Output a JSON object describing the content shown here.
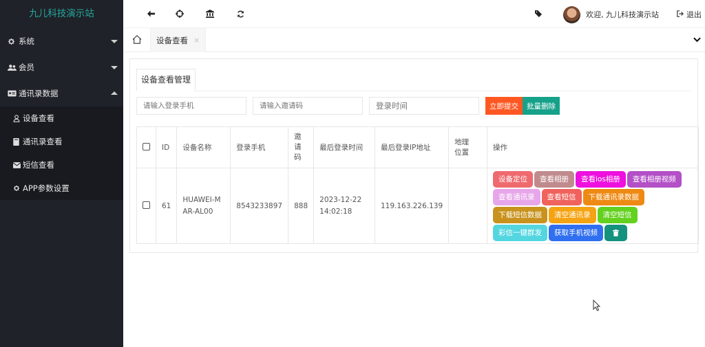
{
  "app": {
    "brand": "九儿科技演示站"
  },
  "sidebar": {
    "items": [
      {
        "label": "系统",
        "icon": "gear-icon",
        "expanded": false
      },
      {
        "label": "会员",
        "icon": "users-icon",
        "expanded": false
      },
      {
        "label": "通讯录数据",
        "icon": "id-card-icon",
        "expanded": true
      }
    ],
    "subitems": [
      {
        "label": "设备查看",
        "icon": "user-icon"
      },
      {
        "label": "通讯录查看",
        "icon": "book-icon"
      },
      {
        "label": "短信查看",
        "icon": "envelope-icon"
      },
      {
        "label": "APP参数设置",
        "icon": "gear-icon"
      }
    ]
  },
  "header": {
    "welcome": "欢迎, 九儿科技演示站",
    "logout": "退出"
  },
  "tabs": {
    "active": "设备查看",
    "close": "×"
  },
  "panel": {
    "title": "设备查看管理"
  },
  "filters": {
    "phone_placeholder": "请输入登录手机",
    "invite_placeholder": "请输入邀请码",
    "time_placeholder": "登录时间",
    "submit": "立即提交",
    "batch_delete": "批量删除"
  },
  "table": {
    "columns": [
      "ID",
      "设备名称",
      "登录手机",
      "邀请码",
      "最后登录时间",
      "最后登录IP地址",
      "地理位置",
      "操作"
    ],
    "rows": [
      {
        "id": "61",
        "device": "HUAWEI-MAR-AL00",
        "phone": "8543233897",
        "invite": "888",
        "last_login": "2023-12-22 14:02:18",
        "ip": "119.163.226.139",
        "location": ""
      }
    ],
    "actions": [
      {
        "label": "设备定位",
        "color": "#ef6a6e"
      },
      {
        "label": "查看相册",
        "color": "#c08b8d"
      },
      {
        "label": "查看ios相册",
        "color": "#ee10de"
      },
      {
        "label": "查看相册视频",
        "color": "#b34fc7"
      },
      {
        "label": "查看通讯录",
        "color": "#e7a6ea"
      },
      {
        "label": "查看短信",
        "color": "#f0625c"
      },
      {
        "label": "下载通讯录数据",
        "color": "#ee8a13"
      },
      {
        "label": "下载短信数据",
        "color": "#c8921d"
      },
      {
        "label": "清空通讯录",
        "color": "#f5a313"
      },
      {
        "label": "清空短信",
        "color": "#63d11e"
      },
      {
        "label": "彩信一键群发",
        "color": "#53d6e0"
      },
      {
        "label": "获取手机视频",
        "color": "#2f6ff0"
      }
    ],
    "delete_color": "#15927d"
  }
}
